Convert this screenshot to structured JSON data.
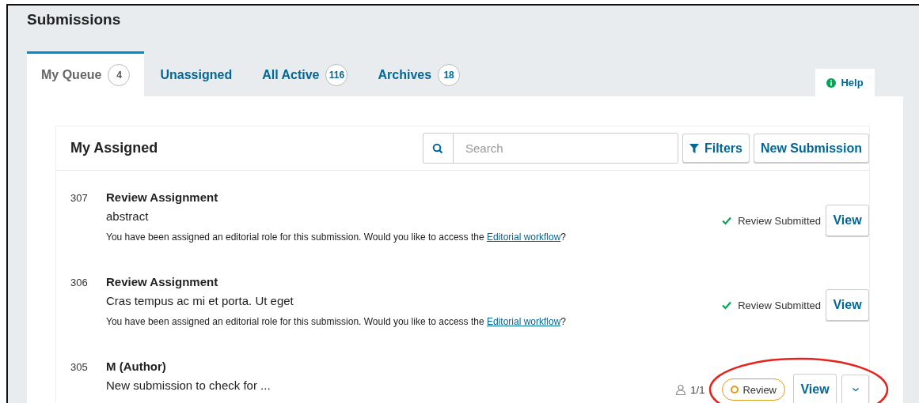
{
  "page_title": "Submissions",
  "tabs": [
    {
      "label": "My Queue",
      "count": "4",
      "selected": true
    },
    {
      "label": "Unassigned",
      "selected": false
    },
    {
      "label": "All Active",
      "count": "116",
      "selected": false
    },
    {
      "label": "Archives",
      "count": "18",
      "selected": false
    }
  ],
  "help": {
    "label": "Help"
  },
  "list": {
    "title": "My Assigned",
    "search": {
      "placeholder": "Search"
    },
    "filters": "Filters",
    "new_button": "New Submission",
    "items": [
      {
        "id": "307",
        "title": "Review Assignment",
        "subtitle": "abstract",
        "notice": {
          "before": "You have been assigned an editorial role for this submission. Would you like to access the ",
          "link": "Editorial workflow",
          "after": "?"
        },
        "status": {
          "kind": "done",
          "label": "Review Submitted"
        },
        "action": "View"
      },
      {
        "id": "306",
        "title": "Review Assignment",
        "subtitle": "Cras tempus ac mi et porta. Ut eget",
        "notice": {
          "before": "You have been assigned an editorial role for this submission. Would you like to access the ",
          "link": "Editorial workflow",
          "after": "?"
        },
        "status": {
          "kind": "done",
          "label": "Review Submitted"
        },
        "action": "View"
      },
      {
        "id": "305",
        "title": "M (Author)",
        "subtitle": "New submission to check for ...",
        "participants": "1/1",
        "status": {
          "kind": "stage",
          "label": "Review"
        },
        "action": "View",
        "menu": true,
        "circled": true
      }
    ]
  }
}
